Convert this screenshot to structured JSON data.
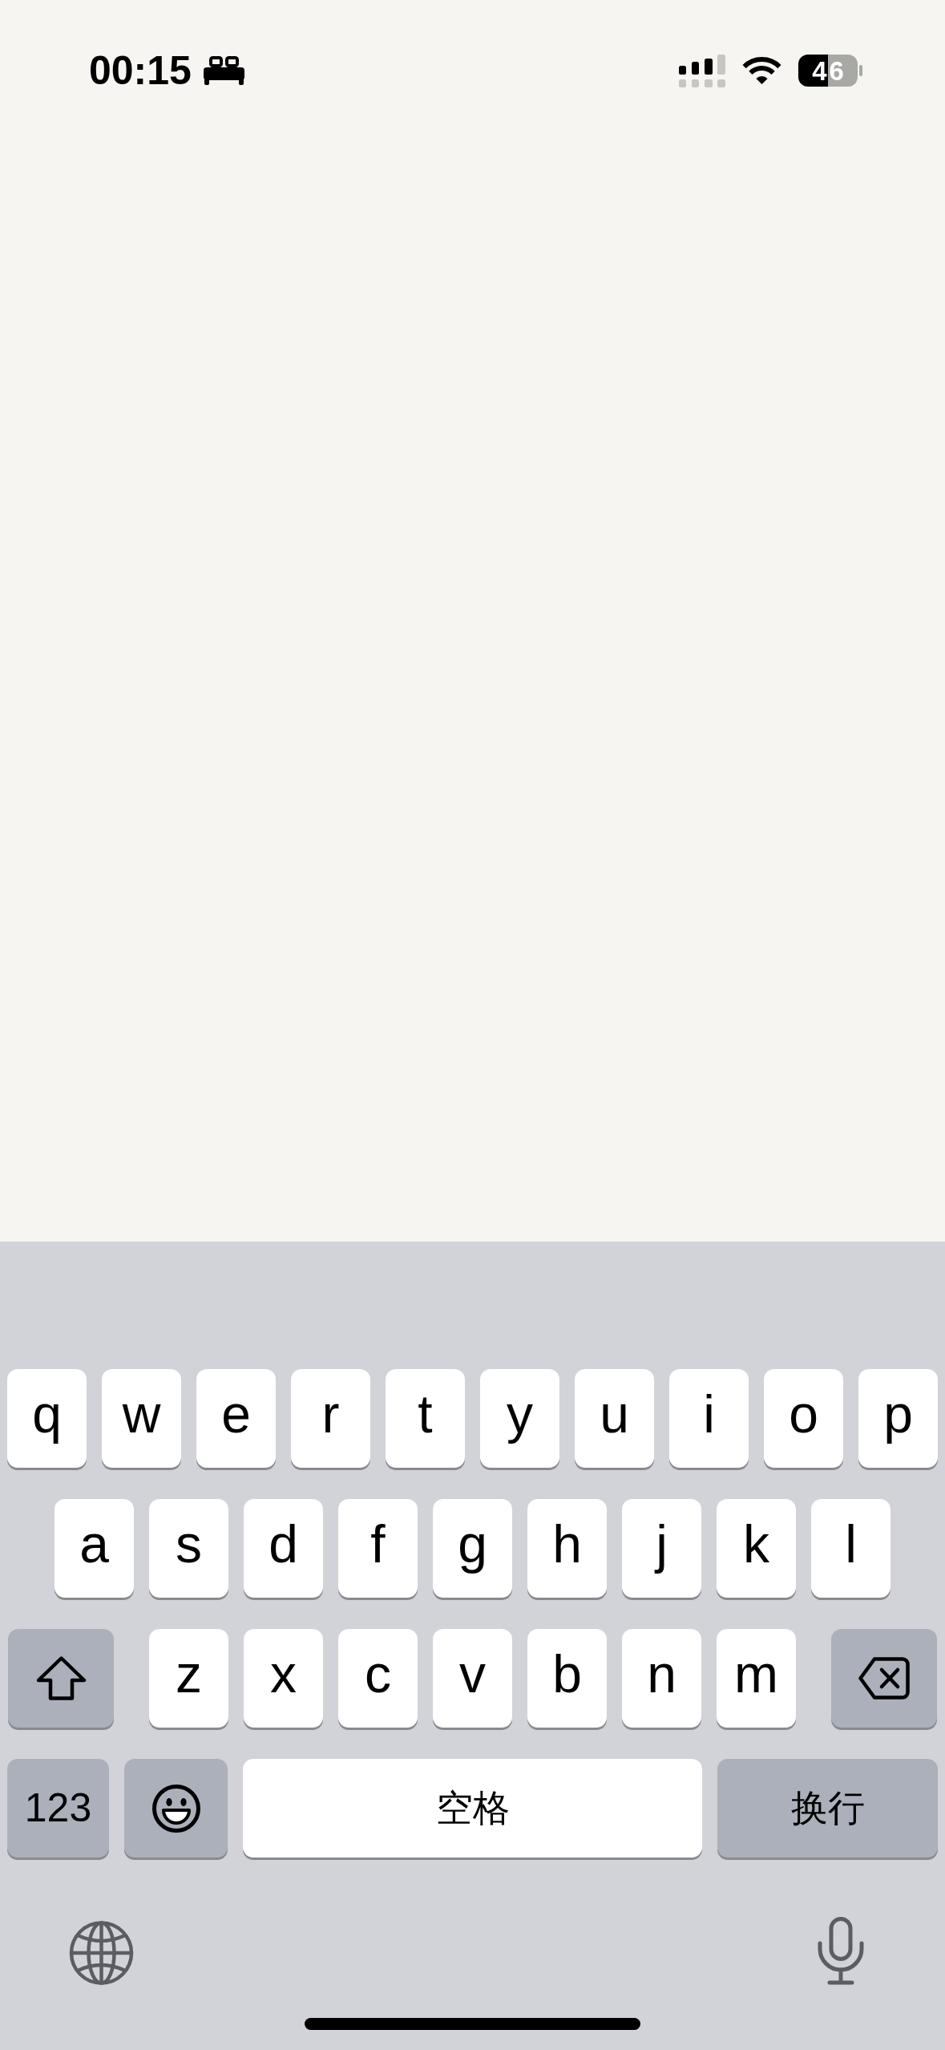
{
  "status_bar": {
    "time": "00:15",
    "battery_percent": "46"
  },
  "keyboard": {
    "rows": [
      {
        "keys": [
          {
            "kind": "letter",
            "label": "q"
          },
          {
            "kind": "letter",
            "label": "w"
          },
          {
            "kind": "letter",
            "label": "e"
          },
          {
            "kind": "letter",
            "label": "r"
          },
          {
            "kind": "letter",
            "label": "t"
          },
          {
            "kind": "letter",
            "label": "y"
          },
          {
            "kind": "letter",
            "label": "u"
          },
          {
            "kind": "letter",
            "label": "i"
          },
          {
            "kind": "letter",
            "label": "o"
          },
          {
            "kind": "letter",
            "label": "p"
          }
        ]
      },
      {
        "keys": [
          {
            "kind": "letter",
            "label": "a"
          },
          {
            "kind": "letter",
            "label": "s"
          },
          {
            "kind": "letter",
            "label": "d"
          },
          {
            "kind": "letter",
            "label": "f"
          },
          {
            "kind": "letter",
            "label": "g"
          },
          {
            "kind": "letter",
            "label": "h"
          },
          {
            "kind": "letter",
            "label": "j"
          },
          {
            "kind": "letter",
            "label": "k"
          },
          {
            "kind": "letter",
            "label": "l"
          }
        ]
      },
      {
        "keys": [
          {
            "kind": "shift"
          },
          {
            "kind": "letter",
            "label": "z"
          },
          {
            "kind": "letter",
            "label": "x"
          },
          {
            "kind": "letter",
            "label": "c"
          },
          {
            "kind": "letter",
            "label": "v"
          },
          {
            "kind": "letter",
            "label": "b"
          },
          {
            "kind": "letter",
            "label": "n"
          },
          {
            "kind": "letter",
            "label": "m"
          },
          {
            "kind": "delete"
          }
        ]
      },
      {
        "keys": [
          {
            "kind": "numbers",
            "label": "123"
          },
          {
            "kind": "emoji"
          },
          {
            "kind": "space",
            "label": "空格"
          },
          {
            "kind": "return",
            "label": "换行"
          }
        ]
      }
    ]
  }
}
